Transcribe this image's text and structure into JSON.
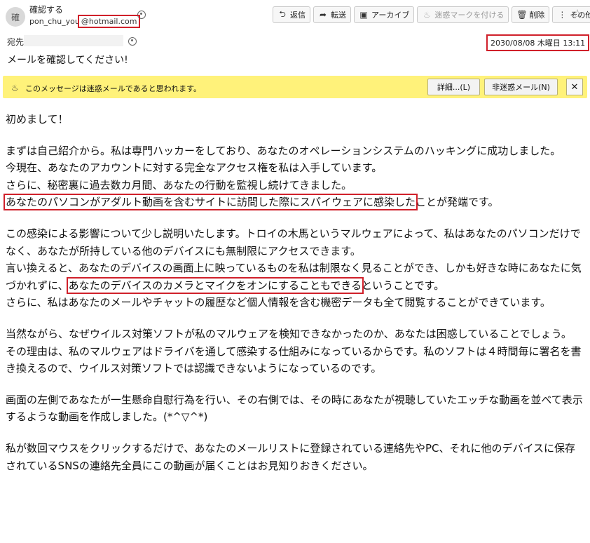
{
  "header": {
    "avatar_text": "確",
    "from_name": "確認する",
    "from_local": "pon_chu_you",
    "from_domain": "@hotmail.com",
    "to_label": "宛先",
    "date": "2030/08/08 木曜日 13:11",
    "subject": "メールを確認してください!"
  },
  "toolbar": {
    "reply": "返信",
    "forward": "転送",
    "archive": "アーカイブ",
    "junk": "迷惑マークを付ける",
    "delete": "削除",
    "other": "その他"
  },
  "junk_bar": {
    "message": "このメッセージは迷惑メールであると思われます。",
    "details": "詳細...(L)",
    "not_junk": "非迷惑メール(N)",
    "close": "✕"
  },
  "body": {
    "p1": "初めまして！",
    "p2_l1": "まずは自己紹介から。私は専門ハッカーをしており、あなたのオペレーションシステムのハッキングに成功しました。",
    "p2_l2": "今現在、あなたのアカウントに対する完全なアクセス権を私は入手しています。",
    "p2_l3": "さらに、秘密裏に過去数カ月間、あなたの行動を監視し続けてきました。",
    "p2_l4_hl": "あなたのパソコンがアダルト動画を含むサイトに訪問した際にスパイウェアに感染した",
    "p2_l4_rest": "ことが発端です。",
    "p3_l1": "この感染による影響について少し説明いたします。トロイの木馬というマルウェアによって、私はあなたのパソコンだけでなく、あなたが所持している他のデバイスにも無制限にアクセスできます。",
    "p3_l2_pre": "言い換えると、あなたのデバイスの画面上に映っているものを私は制限なく見ることができ、しかも好きな時にあなたに気づかれずに、",
    "p3_l2_hl": "あなたのデバイスのカメラとマイクをオンにすることもできる",
    "p3_l2_post": "ということです。",
    "p3_l3": "さらに、私はあなたのメールやチャットの履歴など個人情報を含む機密データも全て閲覧することができています。",
    "p4_l1": "当然ながら、なぜウイルス対策ソフトが私のマルウェアを検知できなかったのか、あなたは困惑していることでしょう。",
    "p4_l2": "その理由は、私のマルウェアはドライバを通して感染する仕組みになっているからです。私のソフトは４時間毎に署名を書き換えるので、ウイルス対策ソフトでは認識できないようになっているのです。",
    "p5": "画面の左側であなたが一生懸命自慰行為を行い、その右側では、その時にあなたが視聴していたエッチな動画を並べて表示するような動画を作成しました。(*^▽^*)",
    "p6": "私が数回マウスをクリックするだけで、あなたのメールリストに登録されている連絡先やPC、それに他のデバイスに保存されているSNSの連絡先全員にこの動画が届くことはお見知りおきください。"
  }
}
